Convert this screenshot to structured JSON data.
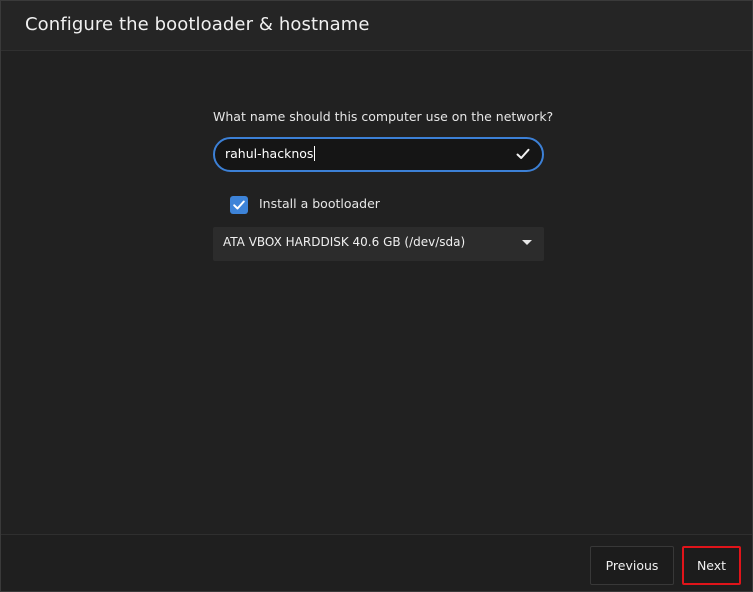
{
  "header": {
    "title": "Configure the bootloader & hostname"
  },
  "hostname": {
    "question": "What name should this computer use on the network?",
    "value": "rahul-hacknos",
    "valid_icon": "checkmark-icon"
  },
  "bootloader": {
    "checkbox_label": "Install a bootloader",
    "checked": true,
    "device_selected": "ATA VBOX HARDDISK 40.6 GB (/dev/sda)"
  },
  "footer": {
    "previous_label": "Previous",
    "next_label": "Next"
  },
  "colors": {
    "accent": "#3d83d8",
    "highlight_border": "#e0141a",
    "background": "#212121"
  }
}
